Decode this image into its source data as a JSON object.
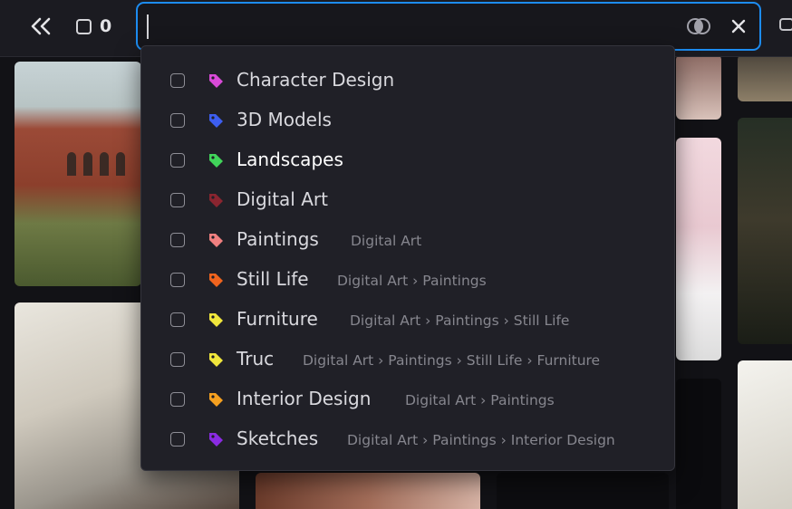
{
  "header": {
    "selected_count": "0",
    "search": {
      "value": "",
      "placeholder": ""
    }
  },
  "tag_options": [
    {
      "label": "Character Design",
      "path": "",
      "color": "#d94ad8"
    },
    {
      "label": "3D Models",
      "path": "",
      "color": "#3d5ef0"
    },
    {
      "label": "Landscapes",
      "path": "",
      "color": "#41d45a",
      "highlighted": true
    },
    {
      "label": "Digital Art",
      "path": "",
      "color": "#8a2530"
    },
    {
      "label": "Paintings",
      "path": "Digital Art",
      "color": "#f08080"
    },
    {
      "label": "Still Life",
      "path": "Digital Art › Paintings",
      "color": "#f0641e"
    },
    {
      "label": "Furniture",
      "path": "Digital Art › Paintings › Still Life",
      "color": "#f0e63c"
    },
    {
      "label": "Truc",
      "path": "Digital Art › Paintings › Still Life › Furniture",
      "color": "#f0e63c"
    },
    {
      "label": "Interior Design",
      "path": "Digital Art › Paintings",
      "color": "#f5a020"
    },
    {
      "label": "Sketches",
      "path": "Digital Art › Paintings › Interior Design",
      "color": "#8a2be2"
    }
  ],
  "colors": {
    "accent": "#1d8cf0",
    "background": "#121216",
    "dropdown": "#202027"
  },
  "icons": {
    "back": "double-chevron-left-icon",
    "select": "checkbox-icon",
    "toggle": "overlap-circles-icon",
    "clear": "close-icon",
    "tag": "tag-icon"
  }
}
